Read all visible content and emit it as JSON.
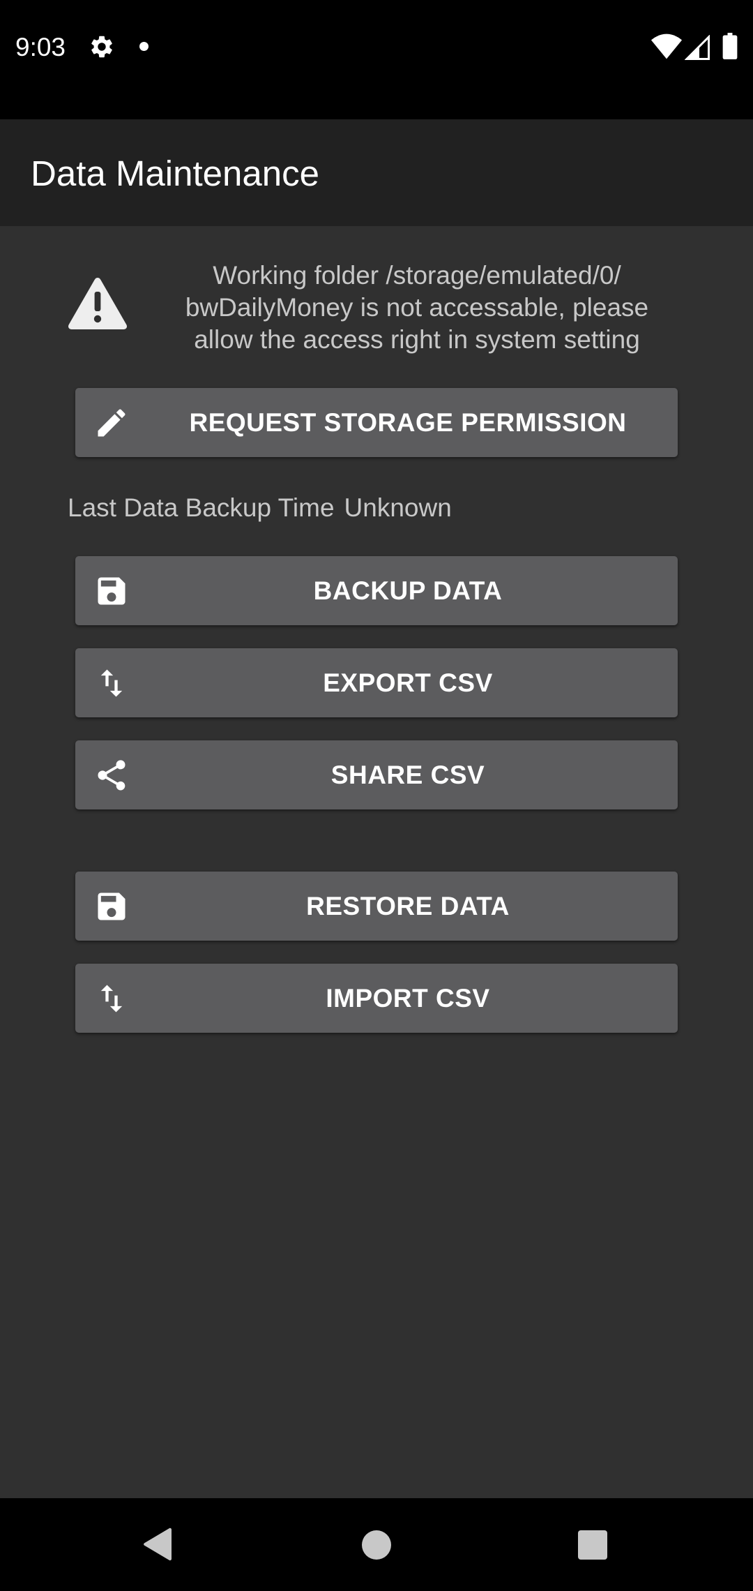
{
  "status_bar": {
    "time": "9:03",
    "icons": [
      "gear-icon",
      "notification-dot",
      "wifi-icon",
      "signal-icon",
      "battery-icon"
    ]
  },
  "toolbar": {
    "title": "Data Maintenance"
  },
  "warning": {
    "icon": "warning-icon",
    "message": "Working folder /storage/emulated/0/ bwDailyMoney is not accessable, please allow the access right in system setting"
  },
  "buttons": {
    "request_permission": {
      "label": "REQUEST STORAGE PERMISSION",
      "icon": "pencil-icon"
    },
    "backup": {
      "label": "BACKUP DATA",
      "icon": "save-icon"
    },
    "export_csv": {
      "label": "EXPORT CSV",
      "icon": "swap-vertical-icon"
    },
    "share_csv": {
      "label": "SHARE CSV",
      "icon": "share-icon"
    },
    "restore": {
      "label": "RESTORE DATA",
      "icon": "save-icon"
    },
    "import_csv": {
      "label": "IMPORT CSV",
      "icon": "swap-vertical-icon"
    }
  },
  "backup_info": {
    "label": "Last Data Backup Time",
    "value": "Unknown"
  },
  "nav_bar": {
    "icons": [
      "back-icon",
      "home-icon",
      "recents-icon"
    ]
  },
  "colors": {
    "background": "#303030",
    "toolbar": "#212121",
    "button": "#5c5c5e",
    "text_secondary": "#c8c8c8",
    "text_primary": "#ffffff"
  }
}
